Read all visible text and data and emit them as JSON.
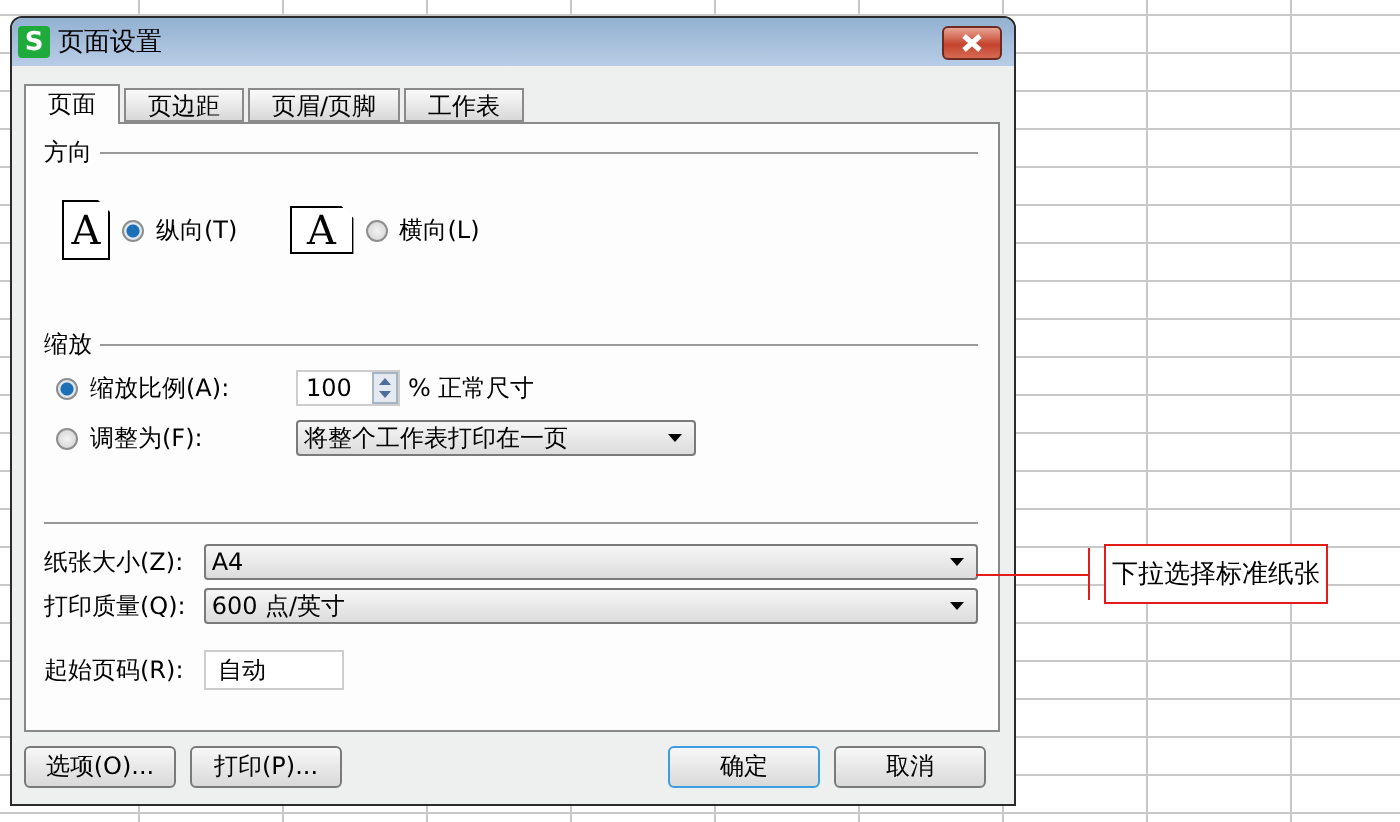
{
  "window": {
    "title": "页面设置",
    "app_icon": "S"
  },
  "tabs": [
    {
      "label": "页面",
      "selected": true
    },
    {
      "label": "页边距",
      "selected": false
    },
    {
      "label": "页眉/页脚",
      "selected": false
    },
    {
      "label": "工作表",
      "selected": false
    }
  ],
  "orientation": {
    "title": "方向",
    "options": [
      {
        "label": "纵向(T)",
        "glyph": "A",
        "kind": "portrait",
        "selected": true
      },
      {
        "label": "横向(L)",
        "glyph": "A",
        "kind": "landscape",
        "selected": false
      }
    ]
  },
  "scaling": {
    "title": "缩放",
    "ratio": {
      "label": "缩放比例(A):",
      "selected": true,
      "value": "100",
      "unit": "% 正常尺寸"
    },
    "fit": {
      "label": "调整为(F):",
      "selected": false,
      "value": "将整个工作表打印在一页"
    }
  },
  "paper_size": {
    "label": "纸张大小(Z):",
    "value": "A4"
  },
  "print_quality": {
    "label": "打印质量(Q):",
    "value": "600 点/英寸"
  },
  "first_page": {
    "label": "起始页码(R):",
    "value": "自动"
  },
  "buttons_left": [
    "选项(O)...",
    "打印(P)..."
  ],
  "buttons_right": [
    {
      "label": "确定",
      "default": true
    },
    {
      "label": "取消",
      "default": false
    }
  ],
  "callout": {
    "text": "下拉选择标准纸张"
  }
}
